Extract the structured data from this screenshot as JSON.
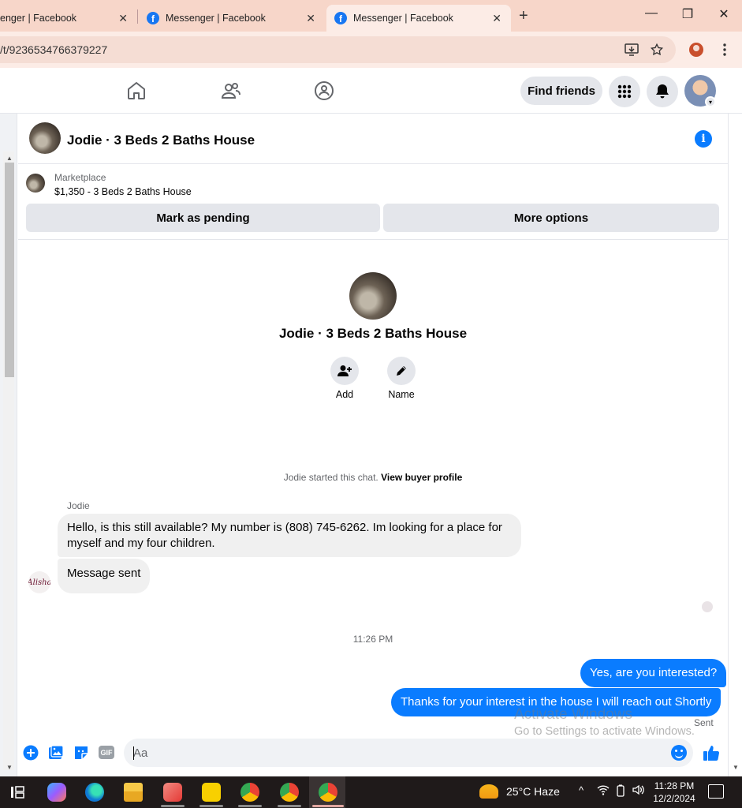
{
  "browser": {
    "tabs": [
      {
        "title": "enger | Facebook",
        "active": false
      },
      {
        "title": "Messenger | Facebook",
        "active": false
      },
      {
        "title": "Messenger | Facebook",
        "active": true
      }
    ],
    "new_tab_label": "+",
    "url": "/t/9236534766379227"
  },
  "fbnav": {
    "find_friends": "Find friends"
  },
  "chat": {
    "title": "Jodie · 3 Beds 2 Baths House",
    "marketplace_label": "Marketplace",
    "listing": "$1,350 - 3 Beds 2 Baths House",
    "mark_pending": "Mark as pending",
    "more_options": "More options",
    "intro_name": "Jodie · 3 Beds 2 Baths House",
    "add_label": "Add",
    "name_label": "Name",
    "started_text": "Jodie started this chat.",
    "view_profile": "View buyer profile",
    "sender_name": "Jodie",
    "messages_in": [
      "Hello, is this still available? My number is (808) 745-6262. Im looking for a place for myself and my four children.",
      "Message sent"
    ],
    "my_avatar_text": "Alisha",
    "timestamp": "11:26 PM",
    "messages_out": [
      "Yes, are you interested?",
      "Thanks for your interest in the house I will reach out Shortly"
    ],
    "status": "Sent",
    "composer_placeholder": "Aa",
    "gif_label": "GIF"
  },
  "watermark": {
    "line1": "Activate Windows",
    "line2": "Go to Settings to activate Windows."
  },
  "taskbar": {
    "weather": "25°C  Haze",
    "time": "11:28 PM",
    "date": "12/2/2024"
  },
  "colors": {
    "messenger_blue": "#0a7cff",
    "fb_blue": "#1877f2",
    "tab_strip": "#f7d6c9",
    "taskbar": "#1f1a1a"
  }
}
